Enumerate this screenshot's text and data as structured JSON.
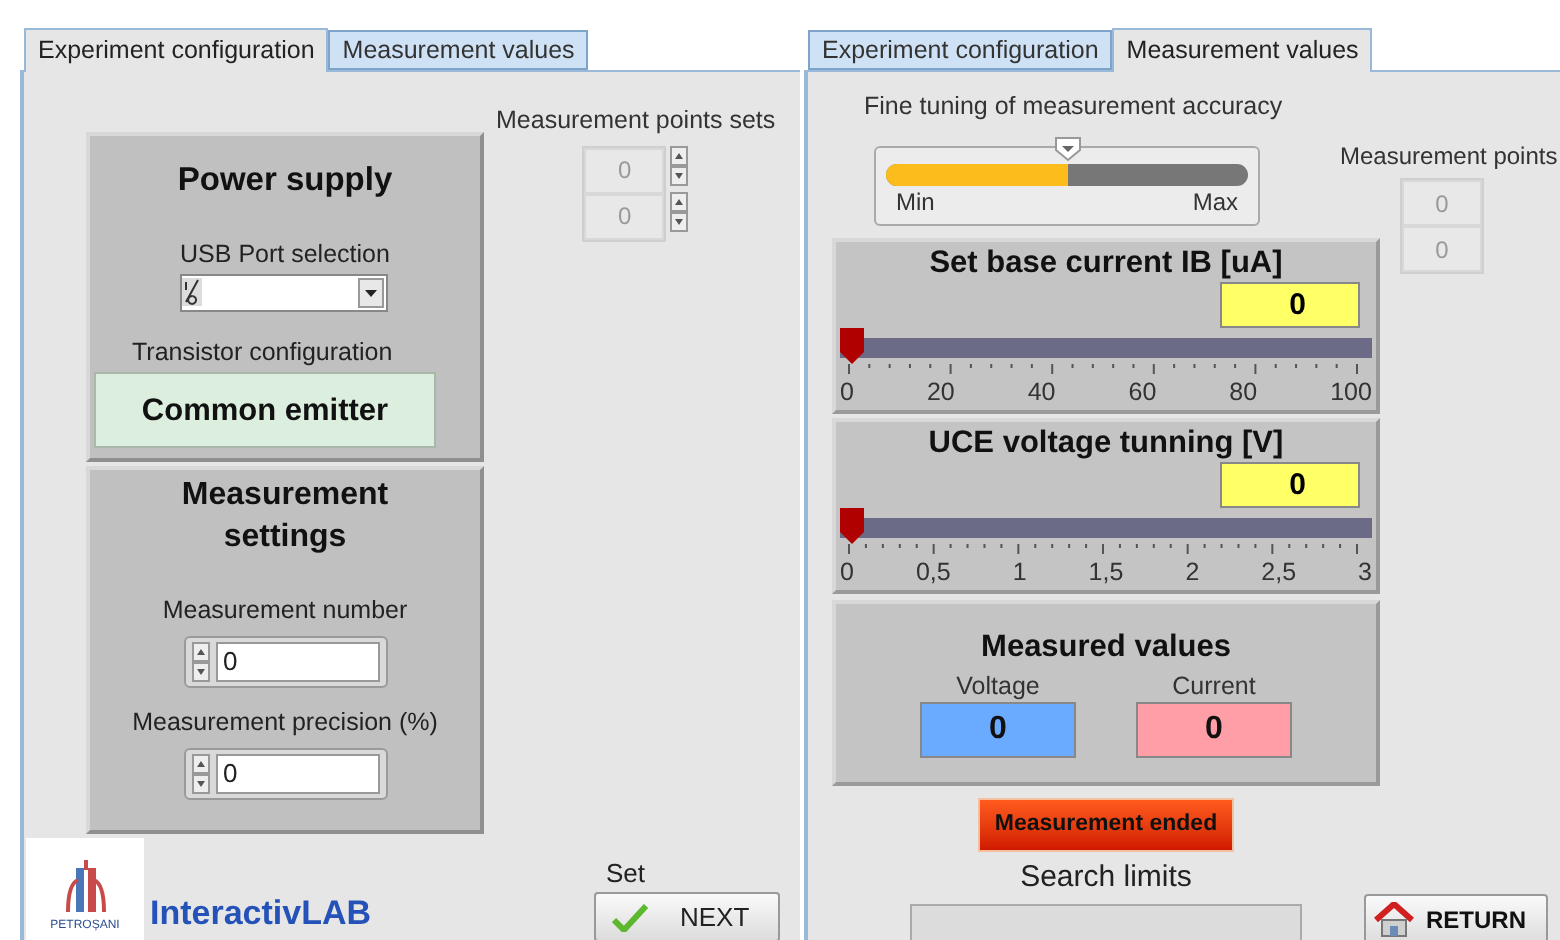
{
  "left_panel": {
    "tabs": [
      {
        "label": "Experiment configuration",
        "selected": true
      },
      {
        "label": "Measurement values",
        "selected": false
      }
    ],
    "power_supply": {
      "title": "Power supply",
      "usb_label": "USB Port selection",
      "transistor_label": "Transistor configuration",
      "transistor_value": "Common emitter"
    },
    "points_sets": {
      "label": "Measurement points sets",
      "values": [
        "0",
        "0"
      ]
    },
    "measurement_settings": {
      "title": "Measurement settings",
      "fields": [
        {
          "label": "Measurement number",
          "value": "0"
        },
        {
          "label": "Measurement precision (%)",
          "value": "0"
        }
      ]
    },
    "logo": {
      "caption": "PETROȘANI",
      "brand": "InteractivLAB"
    },
    "set_label": "Set",
    "next_button": "NEXT"
  },
  "right_panel": {
    "tabs": [
      {
        "label": "Experiment configuration",
        "selected": false
      },
      {
        "label": "Measurement values",
        "selected": true
      }
    ],
    "fine_tuning": {
      "label": "Fine tuning of measurement accuracy",
      "level": 0.5,
      "min": "Min",
      "max": "Max"
    },
    "points": {
      "label": "Measurement points",
      "values": [
        "0",
        "0"
      ]
    },
    "sliders": [
      {
        "title": "Set base current IB [uA]",
        "value": "0",
        "level": 0,
        "ticks": [
          "0",
          "20",
          "40",
          "60",
          "80",
          "100"
        ]
      },
      {
        "title": "UCE voltage tunning [V]",
        "value": "0",
        "level": 0,
        "ticks": [
          "0",
          "0,5",
          "1",
          "1,5",
          "2",
          "2,5",
          "3"
        ]
      }
    ],
    "measured": {
      "title": "Measured values",
      "readings": [
        {
          "label": "Voltage",
          "value": "0",
          "color": "#6aaaff"
        },
        {
          "label": "Current",
          "value": "0",
          "color": "#ff9ea6"
        }
      ]
    },
    "status": {
      "label": "Measurement ended",
      "on": true
    },
    "search_limits": {
      "label": "Search limits"
    },
    "return_button": "RETURN"
  }
}
